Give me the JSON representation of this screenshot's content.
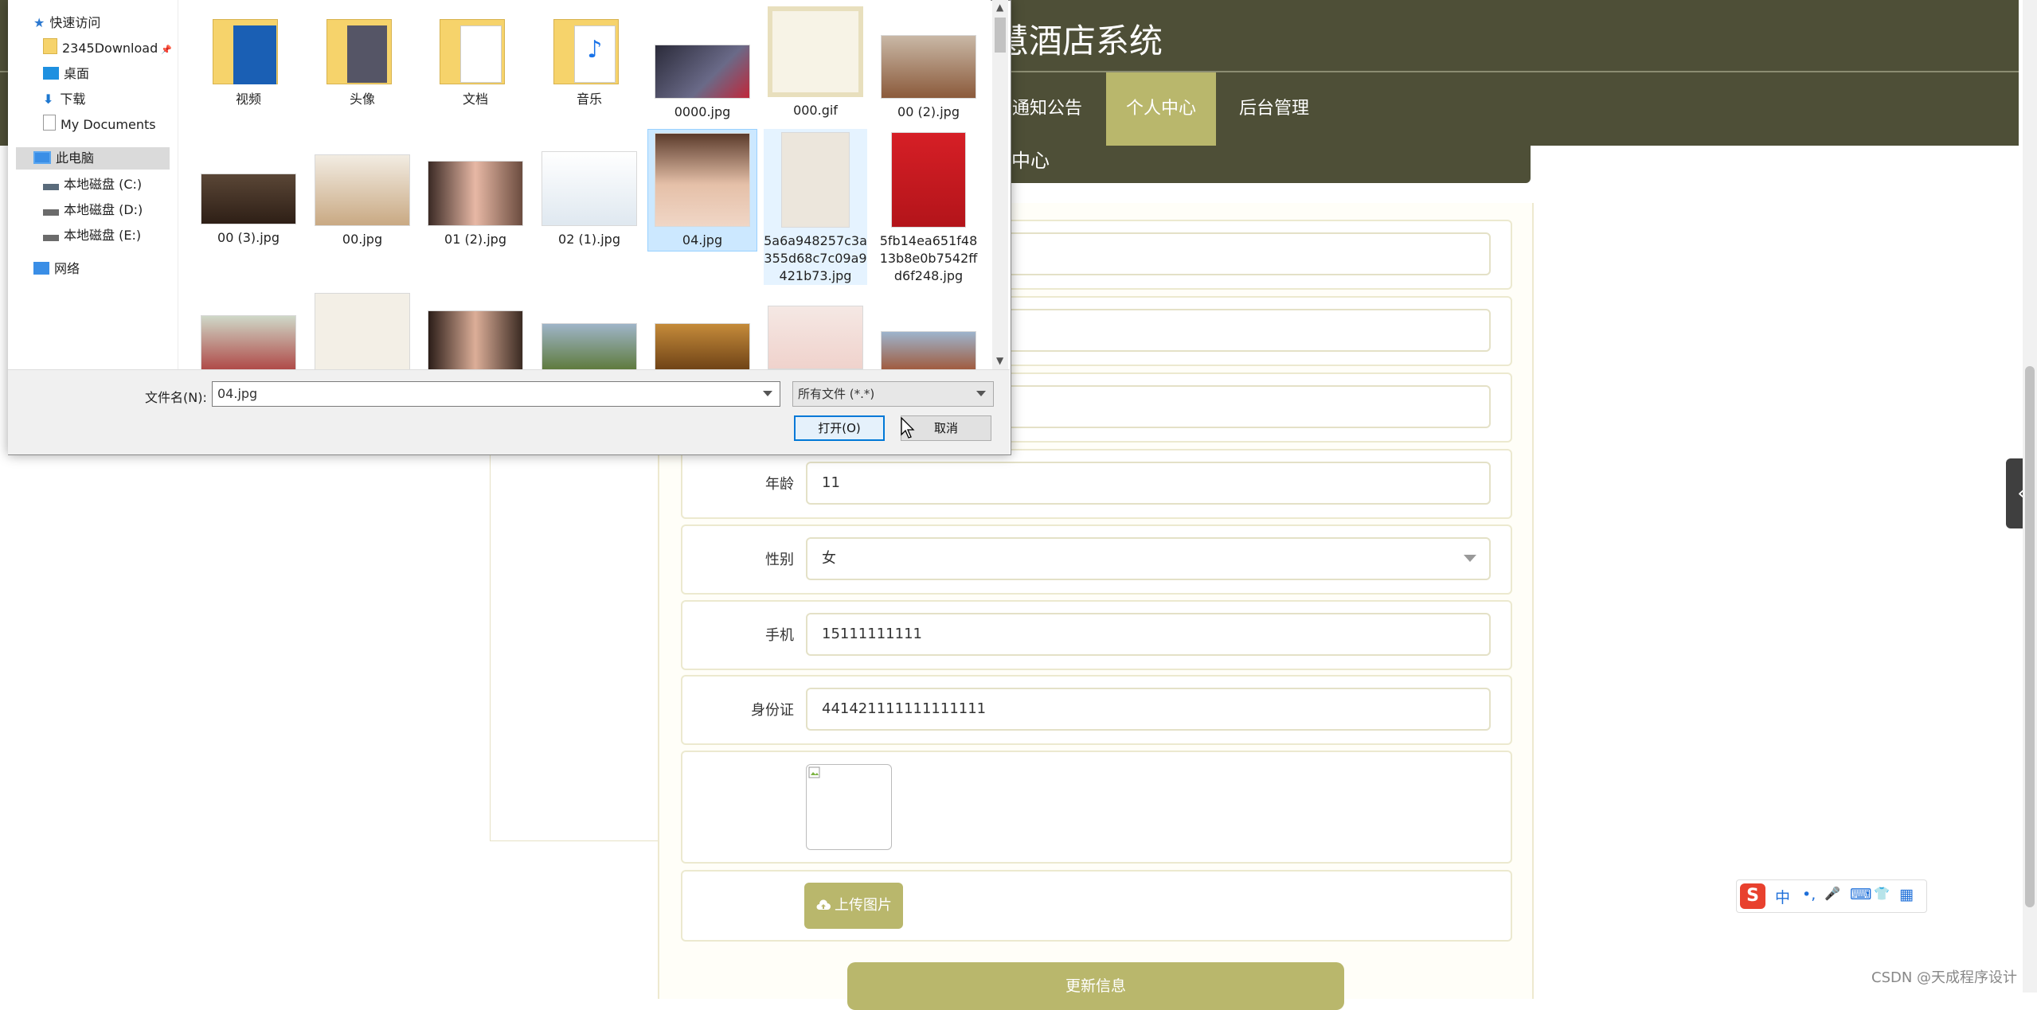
{
  "site": {
    "title": "慧酒店系统",
    "nav": [
      {
        "label": "通知公告",
        "active": false
      },
      {
        "label": "个人中心",
        "active": true
      },
      {
        "label": "后台管理",
        "active": false
      }
    ],
    "section_title": "中心",
    "colors": {
      "header": "#4e4f37",
      "accent": "#b9b76c"
    }
  },
  "form": {
    "age": {
      "label": "年龄",
      "value": "11"
    },
    "gender": {
      "label": "性别",
      "value": "女"
    },
    "phone": {
      "label": "手机",
      "value": "15111111111"
    },
    "id_card": {
      "label": "身份证",
      "value": "441421111111111111"
    },
    "upload_label": "上传图片",
    "update_label": "更新信息"
  },
  "dialog": {
    "nav": {
      "quick_access": "快速访问",
      "downloads_2345": "2345Download",
      "desktop": "桌面",
      "downloads": "下载",
      "my_documents": "My Documents",
      "this_pc": "此电脑",
      "drive_c": "本地磁盘 (C:)",
      "drive_d": "本地磁盘 (D:)",
      "drive_e": "本地磁盘 (E:)",
      "network": "网络"
    },
    "files": [
      {
        "name": "视频",
        "kind": "folder"
      },
      {
        "name": "头像",
        "kind": "folder"
      },
      {
        "name": "文档",
        "kind": "folder"
      },
      {
        "name": "音乐",
        "kind": "folder"
      },
      {
        "name": "0000.jpg",
        "kind": "image"
      },
      {
        "name": "000.gif",
        "kind": "image"
      },
      {
        "name": "00 (2).jpg",
        "kind": "image"
      },
      {
        "name": "00 (3).jpg",
        "kind": "image"
      },
      {
        "name": "00.jpg",
        "kind": "image"
      },
      {
        "name": "01 (2).jpg",
        "kind": "image"
      },
      {
        "name": "02 (1).jpg",
        "kind": "image"
      },
      {
        "name": "04.jpg",
        "kind": "image"
      },
      {
        "name": "5a6a948257c3a355d68c7c09a9421b73.jpg",
        "kind": "image"
      },
      {
        "name": "5fb14ea651f4813b8e0b7542ffd6f248.jpg",
        "kind": "image"
      }
    ],
    "filename_label": "文件名(N):",
    "filename_value": "04.jpg",
    "filter_value": "所有文件 (*.*)",
    "open_label": "打开(O)",
    "cancel_label": "取消"
  },
  "ime": {
    "items": [
      "中",
      "•,",
      "🎤",
      "⌨",
      "👕",
      "▦"
    ]
  },
  "watermark": "CSDN @天成程序设计"
}
